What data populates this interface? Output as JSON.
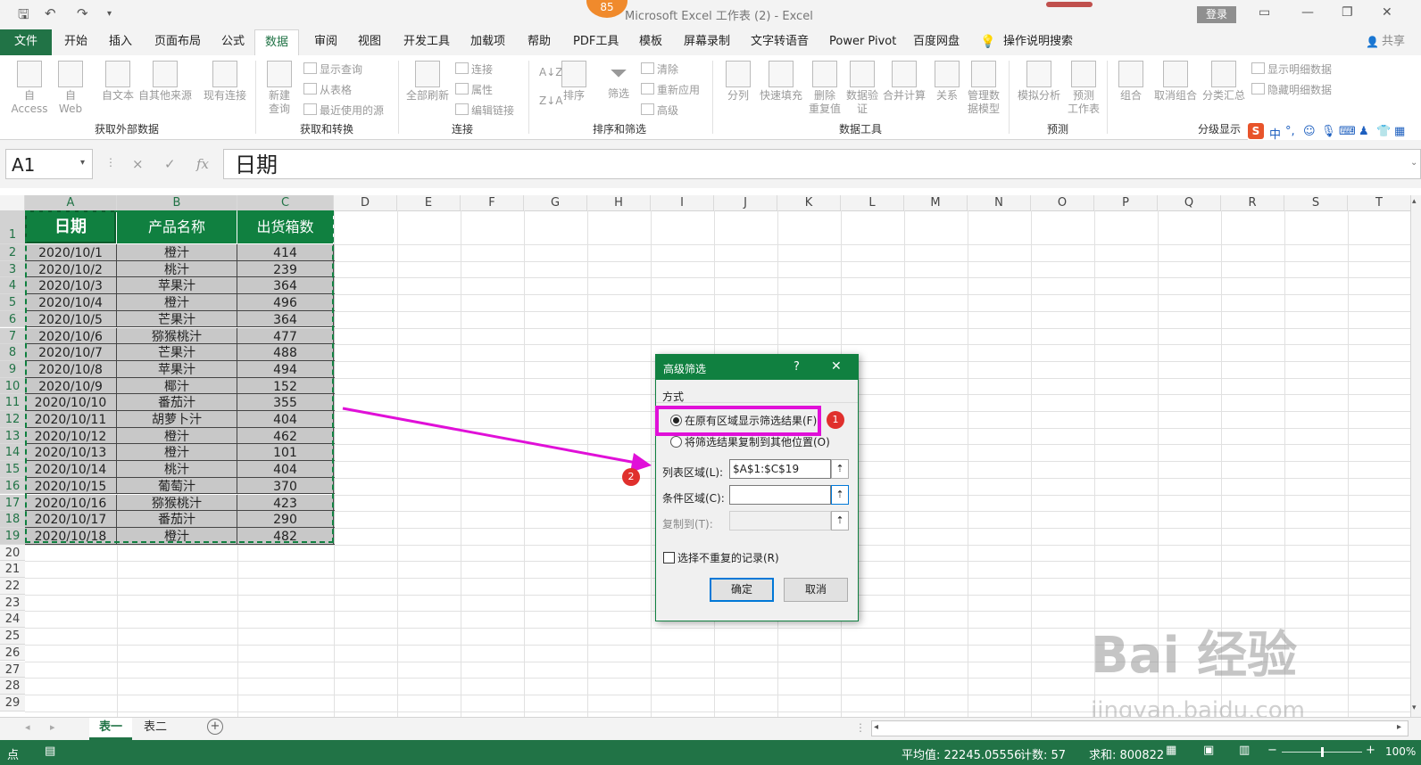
{
  "window": {
    "title": "Microsoft Excel 工作表 (2)  -  Excel",
    "login": "登录",
    "badge": "85"
  },
  "ribbon_tabs": [
    "文件",
    "开始",
    "插入",
    "页面布局",
    "公式",
    "数据",
    "审阅",
    "视图",
    "开发工具",
    "加载项",
    "帮助",
    "PDF工具",
    "模板",
    "屏幕录制",
    "文字转语音",
    "Power Pivot",
    "百度网盘",
    "操作说明搜索"
  ],
  "share": "共享",
  "ribbon": {
    "get_external": {
      "group": "获取外部数据",
      "items": [
        "自 Access",
        "自\nWeb",
        "自文本",
        "自其他来源",
        "现有连接"
      ]
    },
    "get_transform": {
      "group": "获取和转换",
      "items": [
        "新建\n查询",
        "显示查询",
        "从表格",
        "最近使用的源"
      ]
    },
    "connections": {
      "group": "连接",
      "items": [
        "全部刷新",
        "连接",
        "属性",
        "编辑链接"
      ]
    },
    "sort_filter": {
      "group": "排序和筛选",
      "items": [
        "排序",
        "筛选",
        "清除",
        "重新应用",
        "高级"
      ]
    },
    "data_tools": {
      "group": "数据工具",
      "items": [
        "分列",
        "快速填充",
        "删除\n重复值",
        "数据验\n证",
        "合并计算",
        "关系",
        "管理数\n据模型"
      ]
    },
    "forecast": {
      "group": "预测",
      "items": [
        "模拟分析",
        "预测\n工作表"
      ]
    },
    "outline": {
      "group": "分级显示",
      "items": [
        "组合",
        "取消组合",
        "分类汇总",
        "显示明细数据",
        "隐藏明细数据"
      ]
    }
  },
  "ime_label": "中",
  "formula_bar": {
    "name_box": "A1",
    "cancel": "×",
    "enter": "✓",
    "fx": "fx",
    "content": "日期"
  },
  "columns": [
    "A",
    "B",
    "C",
    "D",
    "E",
    "F",
    "G",
    "H",
    "I",
    "J",
    "K",
    "L",
    "M",
    "N",
    "O",
    "P",
    "Q",
    "R",
    "S",
    "T"
  ],
  "rows": [
    "1",
    "2",
    "3",
    "4",
    "5",
    "6",
    "7",
    "8",
    "9",
    "10",
    "11",
    "12",
    "13",
    "14",
    "15",
    "16",
    "17",
    "18",
    "19",
    "20",
    "21",
    "22",
    "23",
    "24",
    "25",
    "26",
    "27",
    "28",
    "29"
  ],
  "table": {
    "headers": [
      "日期",
      "产品名称",
      "出货箱数"
    ],
    "rows": [
      [
        "2020/10/1",
        "橙汁",
        "414"
      ],
      [
        "2020/10/2",
        "桃汁",
        "239"
      ],
      [
        "2020/10/3",
        "苹果汁",
        "364"
      ],
      [
        "2020/10/4",
        "橙汁",
        "496"
      ],
      [
        "2020/10/5",
        "芒果汁",
        "364"
      ],
      [
        "2020/10/6",
        "猕猴桃汁",
        "477"
      ],
      [
        "2020/10/7",
        "芒果汁",
        "488"
      ],
      [
        "2020/10/8",
        "苹果汁",
        "494"
      ],
      [
        "2020/10/9",
        "椰汁",
        "152"
      ],
      [
        "2020/10/10",
        "番茄汁",
        "355"
      ],
      [
        "2020/10/11",
        "胡萝卜汁",
        "404"
      ],
      [
        "2020/10/12",
        "橙汁",
        "462"
      ],
      [
        "2020/10/13",
        "橙汁",
        "101"
      ],
      [
        "2020/10/14",
        "桃汁",
        "404"
      ],
      [
        "2020/10/15",
        "葡萄汁",
        "370"
      ],
      [
        "2020/10/16",
        "猕猴桃汁",
        "423"
      ],
      [
        "2020/10/17",
        "番茄汁",
        "290"
      ],
      [
        "2020/10/18",
        "橙汁",
        "482"
      ]
    ]
  },
  "dialog": {
    "title": "高级筛选",
    "help": "?",
    "close": "✕",
    "section": "方式",
    "option1": "在原有区域显示筛选结果(F)",
    "option2": "将筛选结果复制到其他位置(O)",
    "list_range_label": "列表区域(L):",
    "list_range_value": "$A$1:$C$19",
    "criteria_label": "条件区域(C):",
    "criteria_value": "",
    "copy_to_label": "复制到(T):",
    "copy_to_value": "",
    "unique_label": "选择不重复的记录(R)",
    "ok": "确定",
    "cancel": "取消",
    "marker1": "1",
    "marker2": "2"
  },
  "sheets": [
    "表一",
    "表二"
  ],
  "status": {
    "mode": "点",
    "average": "平均值: 22245.05556",
    "count": "计数: 57",
    "sum": "求和: 800822",
    "zoom": "100%"
  },
  "watermark": {
    "main": "Bai 经验",
    "sub": "jingyan.baidu.com"
  },
  "colors": {
    "excel_green": "#217346",
    "header_green": "#108040",
    "highlight": "#e010d8",
    "marker": "#e0302d"
  }
}
